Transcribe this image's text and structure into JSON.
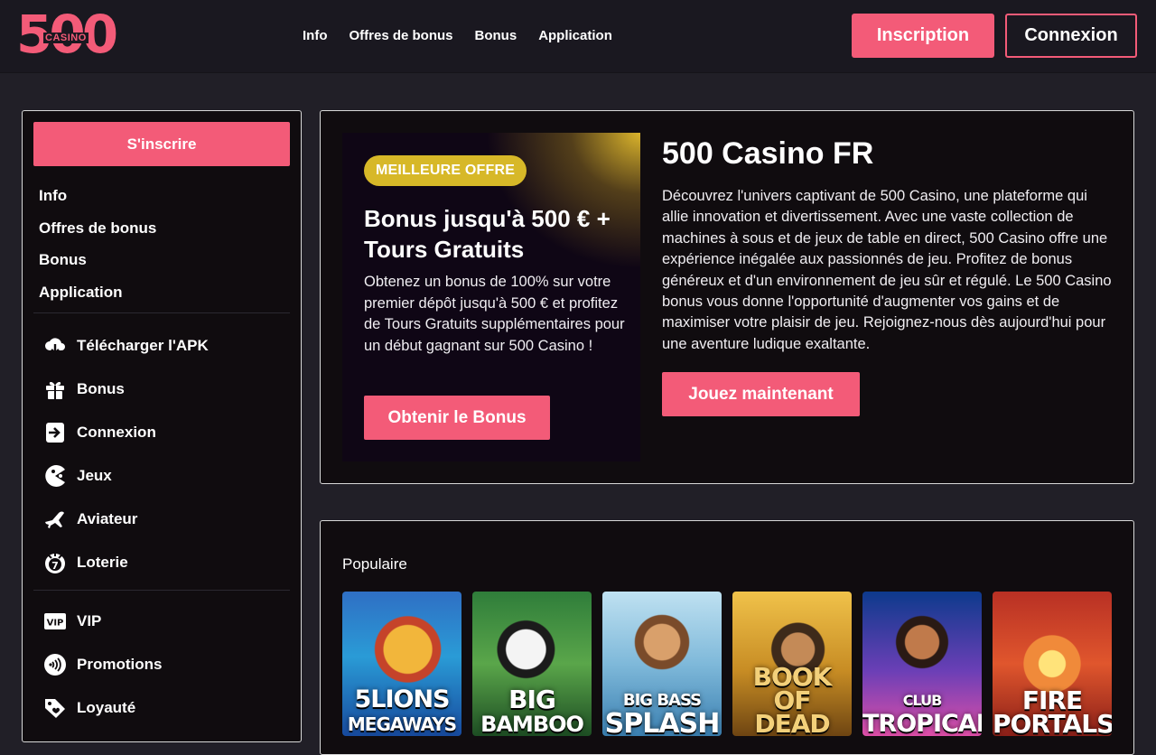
{
  "header": {
    "logo": {
      "number": "500",
      "word": "CASINO"
    },
    "nav": [
      "Info",
      "Offres de bonus",
      "Bonus",
      "Application"
    ],
    "inscription_label": "Inscription",
    "connexion_label": "Connexion"
  },
  "sidebar": {
    "signup_label": "S'inscrire",
    "links": [
      "Info",
      "Offres de bonus",
      "Bonus",
      "Application"
    ],
    "menu": [
      {
        "label": "Télécharger l'APK",
        "icon": "download-cloud-icon"
      },
      {
        "label": "Bonus",
        "icon": "gift-icon"
      },
      {
        "label": "Connexion",
        "icon": "login-icon"
      },
      {
        "label": "Jeux",
        "icon": "pacman-icon"
      },
      {
        "label": "Aviateur",
        "icon": "plane-icon"
      },
      {
        "label": "Loterie",
        "icon": "lottery-icon"
      },
      {
        "label": "VIP",
        "icon": "vip-icon"
      },
      {
        "label": "Promotions",
        "icon": "promotions-icon"
      },
      {
        "label": "Loyauté",
        "icon": "loyalty-tag-icon"
      }
    ]
  },
  "promo": {
    "badge": "MEILLEURE OFFRE",
    "title": "Bonus jusqu'à 500 € + Tours Gratuits",
    "text": "Obtenez un bonus de 100% sur votre premier dépôt jusqu'à 500 € et profitez de Tours Gratuits supplémentaires pour un début gagnant sur 500 Casino !",
    "cta": "Obtenir le Bonus"
  },
  "hero": {
    "title": "500 Casino FR",
    "text": "Découvrez l'univers captivant de 500 Casino, une plateforme qui allie innovation et divertissement. Avec une vaste collection de machines à sous et de jeux de table en direct, 500 Casino offre une expérience inégalée aux passionnés de jeu. Profitez de bonus généreux et d'un environnement de jeu sûr et régulé. Le 500 Casino bonus vous donne l'opportunité d'augmenter vos gains et de maximiser votre plaisir de jeu. Rejoignez-nous dès aujourd'hui pour une aventure ludique exaltante.",
    "cta": "Jouez maintenant"
  },
  "games": {
    "title": "Populaire",
    "items": [
      {
        "name": "5 LIONS MEGAWAYS",
        "line1": "5LIONS",
        "line2": "MEGAWAYS"
      },
      {
        "name": "BIG BAMBOO",
        "line1": "BIG",
        "line2": "BAMBOO"
      },
      {
        "name": "BIG BASS SPLASH",
        "line1": "BIG BASS",
        "line2": "SPLASH"
      },
      {
        "name": "BOOK OF DEAD",
        "line1": "BOOK",
        "line2": "OF DEAD"
      },
      {
        "name": "CLUB TROPICANA",
        "line1": "CLUB",
        "line2": "TROPICANA"
      },
      {
        "name": "FIRE PORTALS",
        "line1": "FIRE",
        "line2": "PORTALS"
      }
    ]
  },
  "colors": {
    "accent": "#f35b78",
    "badge": "#d7b828",
    "background": "#211f27",
    "panel": "#100c0f"
  }
}
